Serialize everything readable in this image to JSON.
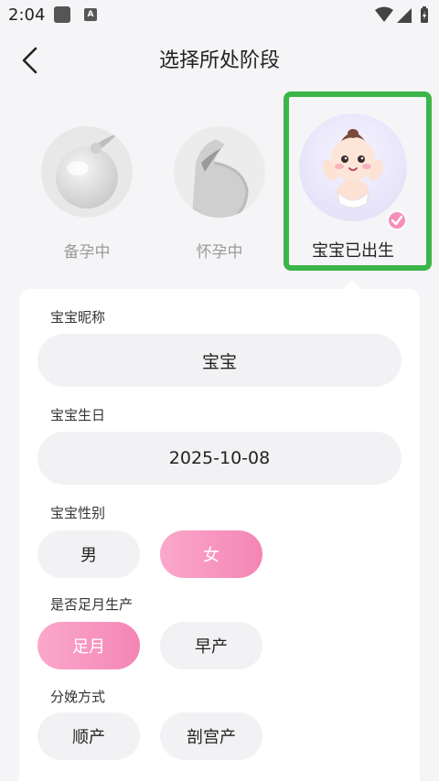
{
  "status_bar": {
    "time": "2:04",
    "a_icon_text": "A"
  },
  "header": {
    "title": "选择所处阶段"
  },
  "stages": [
    {
      "label": "备孕中",
      "selected": false,
      "icon": "bubble-icon"
    },
    {
      "label": "怀孕中",
      "selected": false,
      "icon": "pregnant-belly-icon"
    },
    {
      "label": "宝宝已出生",
      "selected": true,
      "icon": "baby-avatar-icon"
    }
  ],
  "form": {
    "nickname": {
      "label": "宝宝昵称",
      "value": "宝宝"
    },
    "birthday": {
      "label": "宝宝生日",
      "value": "2025-10-08"
    },
    "gender": {
      "label": "宝宝性别",
      "options": [
        "男",
        "女"
      ],
      "selected": "女"
    },
    "term": {
      "label": "是否足月生产",
      "options": [
        "足月",
        "早产"
      ],
      "selected": "足月"
    },
    "delivery": {
      "label": "分娩方式",
      "options": [
        "顺产",
        "剖宫产"
      ]
    }
  },
  "colors": {
    "accent_pink": "#f485b5",
    "highlight_green": "#3cb54a"
  }
}
